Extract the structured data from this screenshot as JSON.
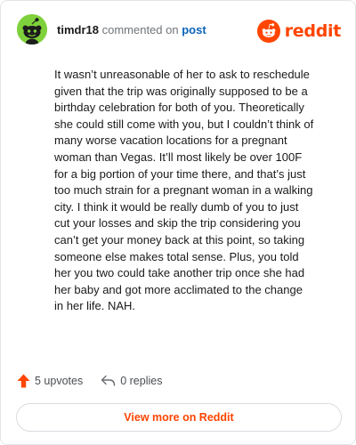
{
  "comment": {
    "username": "timdr18",
    "action": "commented on",
    "target_link": "post",
    "body": "It wasn’t unreasonable of her to ask to reschedule given that the trip was originally supposed to be a birthday celebration for both of you. Theoretically she could still come with you, but I couldn’t think of many worse vacation locations for a pregnant woman than Vegas. It’ll most likely be over 100F for a big portion of your time there, and that’s just too much strain for a pregnant woman in a walking city. I think it would be really dumb of you to just cut your losses and skip the trip considering you can’t get your money back at this point, so taking someone else makes total sense. Plus, you told her you two could take another trip once she had her baby and got more acclimated to the change in her life. NAH.",
    "upvotes_label": "5 upvotes",
    "replies_label": "0 replies"
  },
  "brand": {
    "wordmark": "reddit",
    "icon": "reddit-snoo-icon"
  },
  "avatar": {
    "icon": "snoo-avatar-icon"
  },
  "footer": {
    "view_more_label": "View more on Reddit"
  },
  "colors": {
    "accent": "#ff4500",
    "avatar_background": "#7fd13b",
    "link": "#0a63b8",
    "text": "#1a1a1b",
    "muted": "#6f7479"
  }
}
